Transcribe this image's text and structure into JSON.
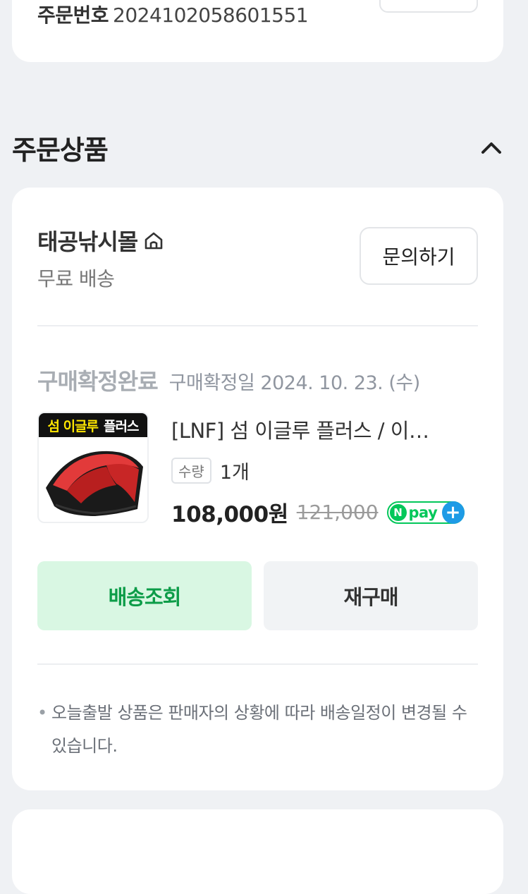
{
  "order": {
    "label": "주문번호",
    "number": "2024102058601551"
  },
  "section": {
    "title": "주문상품"
  },
  "store": {
    "name": "태공낚시몰",
    "shipping": "무료 배송",
    "inquiry_label": "문의하기"
  },
  "item": {
    "status": "구매확정완료",
    "status_date": "구매확정일 2024. 10. 23. (수)",
    "thumbnail_banner_yellow": "섬 이글루",
    "thumbnail_banner_white": "플러스",
    "title": "[LNF] 섬 이글루 플러스 / 이…",
    "qty_label": "수량",
    "qty_value": "1개",
    "price": "108,000원",
    "original_price": "121,000",
    "npay_n": "N",
    "npay_text": "pay",
    "npay_plus": "+"
  },
  "actions": {
    "track_label": "배송조회",
    "rebuy_label": "재구매"
  },
  "notice": {
    "bullet": "•",
    "text": "오늘출발 상품은 판매자의 상황에 따라 배송일정이 변경될 수 있습니다."
  },
  "colors": {
    "background": "#eff1f4",
    "card": "#ffffff",
    "naver_green": "#03c75a",
    "track_bg": "#d9f7e3",
    "track_text": "#0c9c48"
  },
  "icons": {
    "collapse": "chevron-up-icon",
    "store_home": "home-icon"
  }
}
